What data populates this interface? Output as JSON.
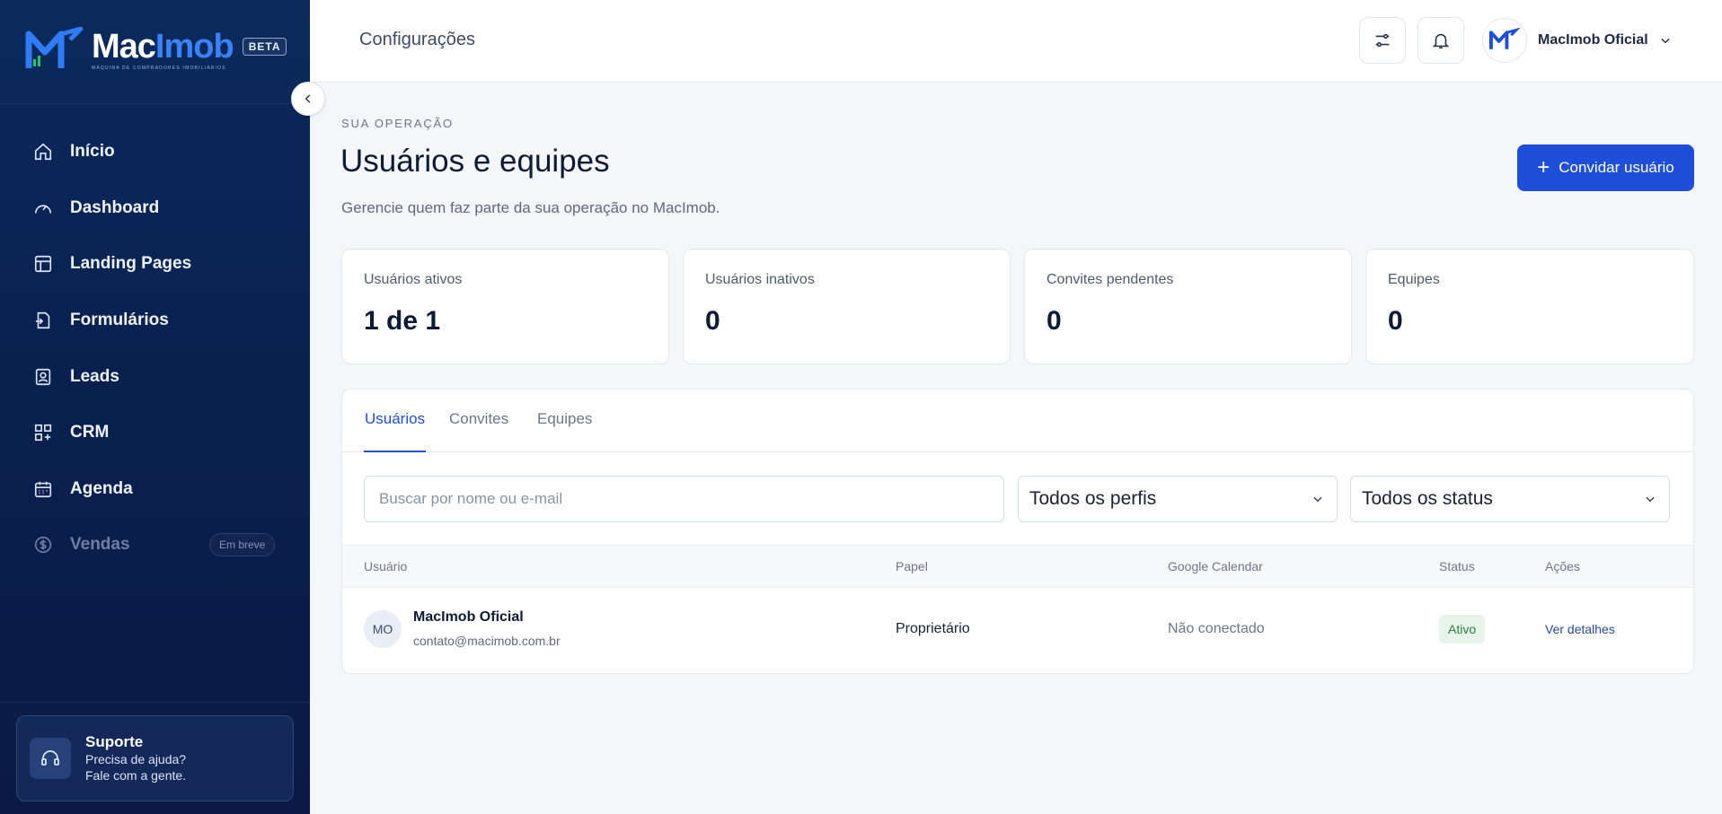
{
  "brand": {
    "name_part1": "Mac",
    "name_part2": "Imob",
    "tagline": "MÁQUINA DE COMPRADORES IMOBILIÁRIOS",
    "badge": "BETA",
    "primary_color": "#1f4fd8",
    "sidebar_color": "#0a2150"
  },
  "sidebar": {
    "items": [
      {
        "label": "Início",
        "icon": "home-icon"
      },
      {
        "label": "Dashboard",
        "icon": "gauge-icon"
      },
      {
        "label": "Landing Pages",
        "icon": "layout-icon"
      },
      {
        "label": "Formulários",
        "icon": "form-icon"
      },
      {
        "label": "Leads",
        "icon": "contact-icon"
      },
      {
        "label": "CRM",
        "icon": "grid-plus-icon"
      },
      {
        "label": "Agenda",
        "icon": "calendar-icon"
      },
      {
        "label": "Vendas",
        "icon": "dollar-icon",
        "badge": "Em breve"
      }
    ],
    "support": {
      "title": "Suporte",
      "line1": "Precisa de ajuda?",
      "line2": "Fale com a gente."
    }
  },
  "header": {
    "title": "Configurações",
    "user_name": "MacImob Oficial"
  },
  "page": {
    "eyebrow": "SUA OPERAÇÃO",
    "title": "Usuários e equipes",
    "subtitle": "Gerencie quem faz parte da sua operação no MacImob.",
    "invite_button": "Convidar usuário"
  },
  "stats": [
    {
      "label": "Usuários ativos",
      "value": "1 de 1"
    },
    {
      "label": "Usuários inativos",
      "value": "0"
    },
    {
      "label": "Convites pendentes",
      "value": "0"
    },
    {
      "label": "Equipes",
      "value": "0"
    }
  ],
  "tabs": [
    {
      "label": "Usuários",
      "active": true
    },
    {
      "label": "Convites",
      "active": false
    },
    {
      "label": "Equipes",
      "active": false
    }
  ],
  "filters": {
    "search_placeholder": "Buscar por nome ou e-mail",
    "profile_select": "Todos os perfis",
    "status_select": "Todos os status"
  },
  "table": {
    "columns": [
      "Usuário",
      "Papel",
      "Google Calendar",
      "Status",
      "Ações"
    ],
    "rows": [
      {
        "initials": "MO",
        "name": "MacImob Oficial",
        "email": "contato@macimob.com.br",
        "role": "Proprietário",
        "google_calendar": "Não conectado",
        "status": "Ativo",
        "action": "Ver detalhes"
      }
    ]
  }
}
